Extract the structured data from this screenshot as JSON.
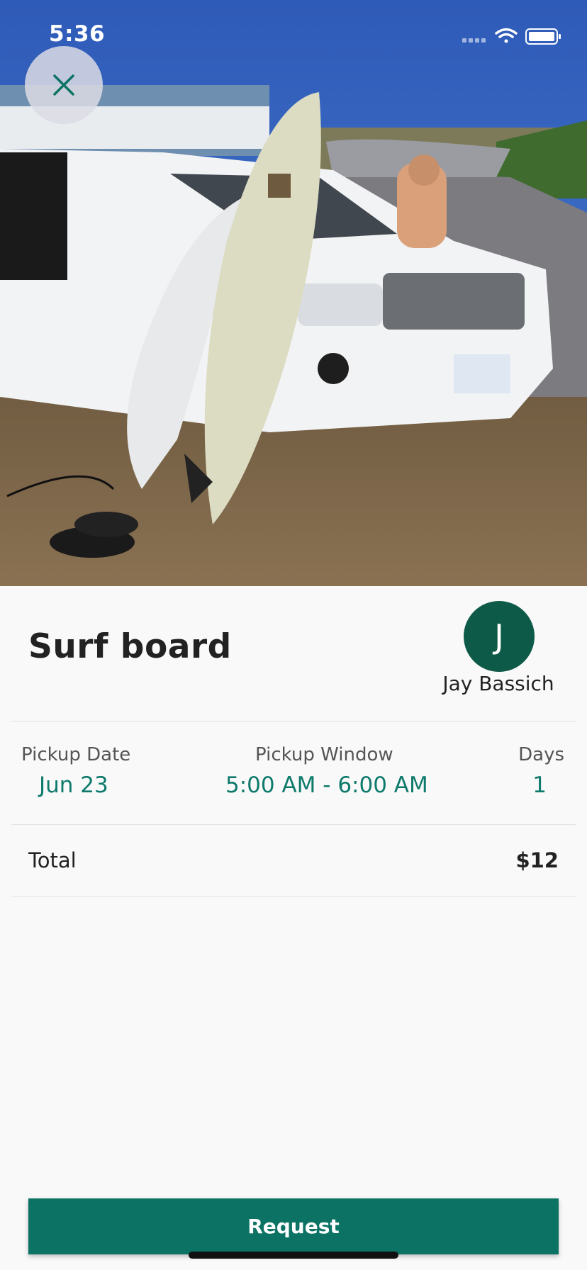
{
  "status_bar": {
    "time": "5:36"
  },
  "hero": {
    "image_description_icon": "photo-surfboards-car-beach"
  },
  "close_icon": "close-icon",
  "listing": {
    "title": "Surf board"
  },
  "owner": {
    "initial": "J",
    "name": "Jay Bassich"
  },
  "details": {
    "pickup_date_label": "Pickup Date",
    "pickup_date_value": "Jun 23",
    "pickup_window_label": "Pickup Window",
    "pickup_window_value": "5:00 AM - 6:00 AM",
    "days_label": "Days",
    "days_value": "1"
  },
  "total": {
    "label": "Total",
    "value": "$12"
  },
  "actions": {
    "request_label": "Request"
  },
  "colors": {
    "accent": "#0c7364",
    "accent_text": "#0e7a6c",
    "avatar": "#0d5a48"
  }
}
